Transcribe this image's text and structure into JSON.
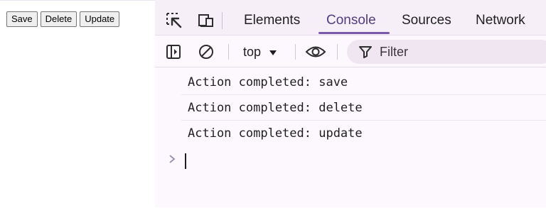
{
  "page": {
    "buttons": [
      {
        "label": "Save"
      },
      {
        "label": "Delete"
      },
      {
        "label": "Update"
      }
    ]
  },
  "devtools": {
    "tabs": [
      {
        "label": "Elements"
      },
      {
        "label": "Console",
        "active": true
      },
      {
        "label": "Sources"
      },
      {
        "label": "Network"
      }
    ],
    "toolbar": {
      "context": "top",
      "filter_label": "Filter"
    },
    "console": {
      "lines": [
        "Action completed: save",
        "Action completed: delete",
        "Action completed: update"
      ]
    },
    "icons": {
      "inspect": "inspect-element-icon",
      "device": "device-toolbar-icon",
      "sidebar": "show-sidebar-icon",
      "clear": "clear-console-icon",
      "dropdown": "dropdown-arrow-icon",
      "eye": "live-expression-icon",
      "filter": "filter-icon",
      "prompt": "prompt-chevron-icon"
    },
    "colors": {
      "accent": "#7a5aa8",
      "active_tab_text": "#4d3f7d",
      "panel_bg": "#fdf8fd"
    }
  }
}
